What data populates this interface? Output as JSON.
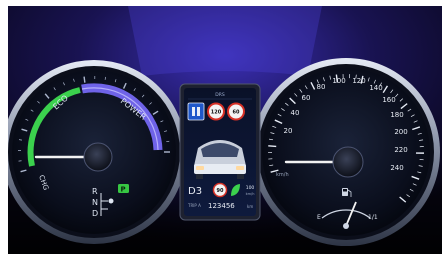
{
  "colors": {
    "ambient": "#3b2fb5",
    "eco_arc": "#3bd14d",
    "power_arc": "#6f63e8",
    "needle": "#f2f2f2",
    "lcd_bg": "#0c1530"
  },
  "hybrid_gauge": {
    "zone_labels": {
      "chg": "CHG",
      "eco": "ECO",
      "power": "POWER"
    },
    "gear_letters": [
      "R",
      "N",
      "D"
    ],
    "park_indicator": "P"
  },
  "center_display": {
    "header": "DRS",
    "signs": {
      "overtaking": "overtake-sign-icon",
      "limit_left": "120",
      "limit_right": "60"
    },
    "car": "car-icon",
    "gear": "D3",
    "speed_limit": "90",
    "eco_icon": "eco-leaf-icon",
    "rate_value": "100",
    "rate_unit": "km/h",
    "trip_label": "TRIP A",
    "odometer": "123456",
    "odometer_unit": "km"
  },
  "speedometer": {
    "ticks": [
      "20",
      "40",
      "60",
      "80",
      "100",
      "120",
      "140",
      "160",
      "180",
      "200",
      "220",
      "240"
    ],
    "unit": "km/h",
    "fuel": {
      "empty": "E",
      "full": "1/1"
    }
  }
}
